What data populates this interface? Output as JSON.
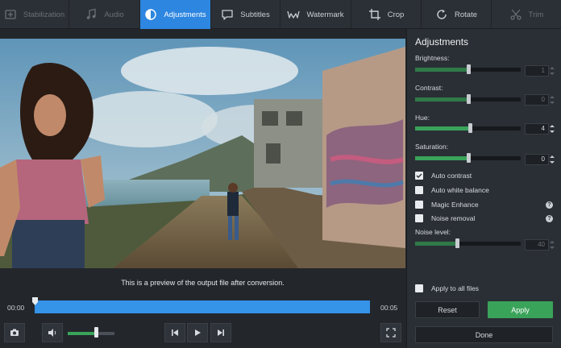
{
  "toolbar": {
    "tabs": [
      {
        "label": "Stabilization",
        "icon": "stabilization-icon",
        "state": "disabled"
      },
      {
        "label": "Audio",
        "icon": "music-note-icon",
        "state": "disabled"
      },
      {
        "label": "Adjustments",
        "icon": "contrast-icon",
        "state": "active"
      },
      {
        "label": "Subtitles",
        "icon": "speech-bubble-icon",
        "state": "normal"
      },
      {
        "label": "Watermark",
        "icon": "watermark-icon",
        "state": "normal"
      },
      {
        "label": "Crop",
        "icon": "crop-icon",
        "state": "normal"
      },
      {
        "label": "Rotate",
        "icon": "rotate-icon",
        "state": "normal"
      },
      {
        "label": "Trim",
        "icon": "scissors-icon",
        "state": "disabled"
      }
    ]
  },
  "preview": {
    "caption": "This is a preview of the output file after conversion."
  },
  "playback": {
    "time_start": "00:00",
    "time_end": "00:05",
    "position_fraction": 0.0,
    "volume_fraction": 0.6
  },
  "panel": {
    "title": "Adjustments",
    "sliders": [
      {
        "label": "Brightness:",
        "value": "1",
        "fraction": 0.5,
        "enabled": false
      },
      {
        "label": "Contrast:",
        "value": "0",
        "fraction": 0.5,
        "enabled": false
      },
      {
        "label": "Hue:",
        "value": "4",
        "fraction": 0.52,
        "enabled": true
      },
      {
        "label": "Saturation:",
        "value": "0",
        "fraction": 0.5,
        "enabled": true
      }
    ],
    "options": [
      {
        "label": "Auto contrast",
        "checked": true,
        "help": false
      },
      {
        "label": "Auto white balance",
        "checked": false,
        "help": false
      },
      {
        "label": "Magic Enhance",
        "checked": false,
        "help": true
      },
      {
        "label": "Noise removal",
        "checked": false,
        "help": true
      }
    ],
    "noise": {
      "label": "Noise level:",
      "value": "40",
      "fraction": 0.4,
      "enabled": false
    },
    "apply_all": {
      "label": "Apply to all files",
      "checked": false
    },
    "reset_label": "Reset",
    "apply_label": "Apply",
    "done_label": "Done"
  },
  "colors": {
    "accent": "#2d86e0",
    "timeline": "#3593e8",
    "green": "#3aa35a",
    "panel_bg": "#2a2f35"
  }
}
